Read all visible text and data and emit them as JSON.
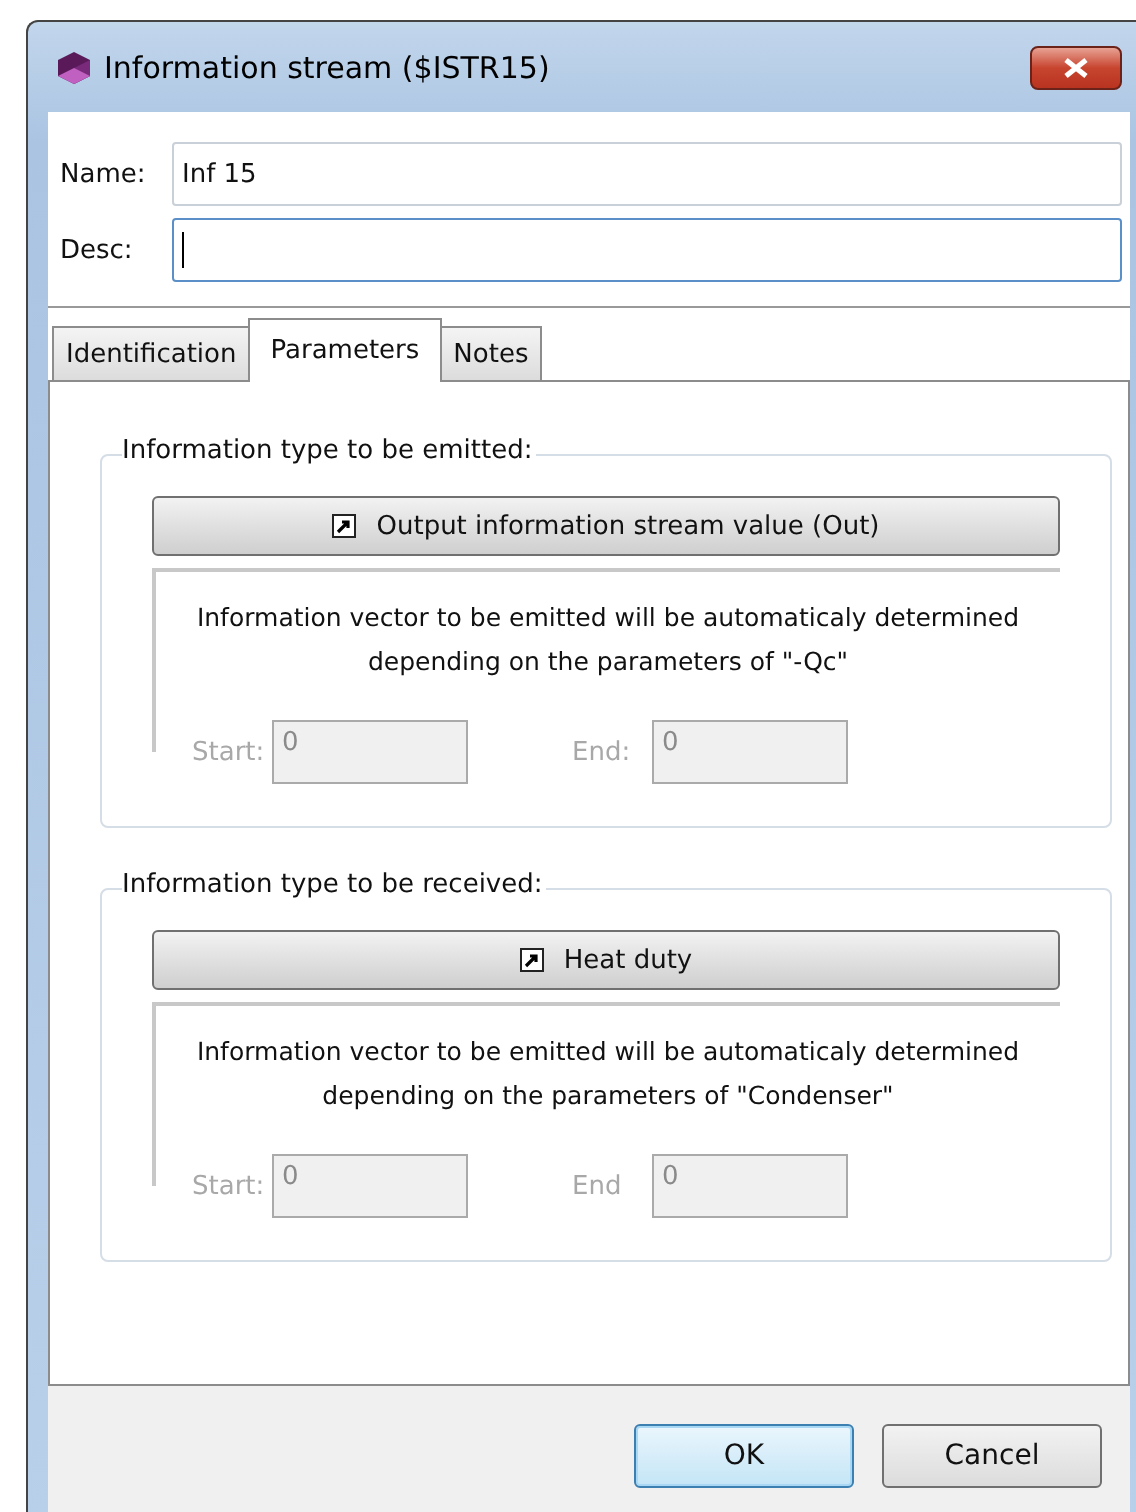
{
  "window": {
    "title": "Information stream ($ISTR15)"
  },
  "fields": [
    {
      "label": "Name:",
      "value": "Inf 15",
      "focused": false
    },
    {
      "label": "Desc:",
      "focused": true
    }
  ],
  "tabs": [
    {
      "label": "Identification",
      "selected": false
    },
    {
      "label": "Parameters",
      "selected": true
    },
    {
      "label": "Notes",
      "selected": false
    }
  ],
  "groups": [
    {
      "title": "Information type to be emitted:",
      "button": "Output information stream value (Out)",
      "message": "Information vector to be emitted will be automaticaly determined depending on the parameters of \"-Qc\"",
      "range": [
        {
          "label": "Start:",
          "value": "0",
          "disabled": true
        },
        {
          "label": "End:",
          "value": "0",
          "disabled": true
        }
      ]
    },
    {
      "title": "Information type to be received:",
      "button": "Heat duty",
      "message": "Information vector to be emitted will be automaticaly determined depending on the parameters of \"Condenser\"",
      "range": [
        {
          "label": "Start:",
          "value": "0",
          "disabled": true
        },
        {
          "label": "End",
          "value": "0",
          "disabled": true
        }
      ]
    }
  ],
  "buttons": [
    {
      "label": "OK",
      "default": true
    },
    {
      "label": "Cancel",
      "default": false
    }
  ]
}
